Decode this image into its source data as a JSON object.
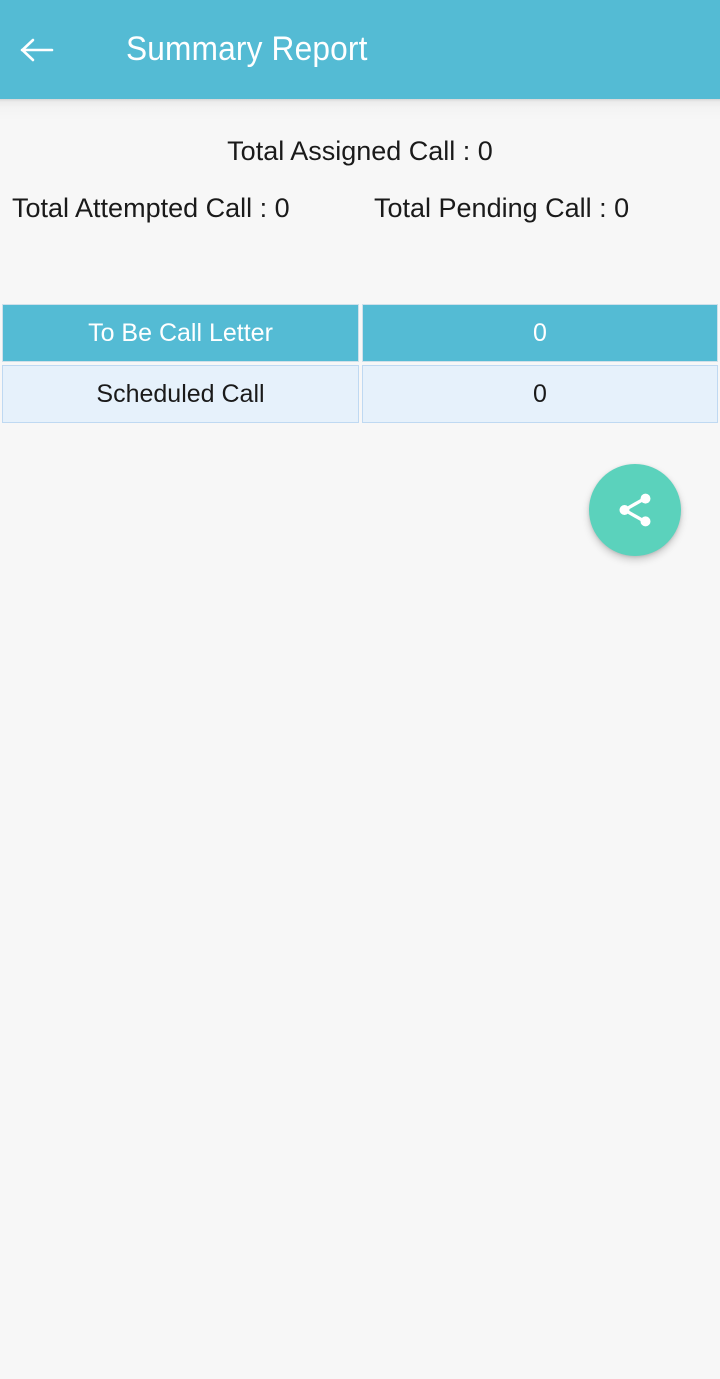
{
  "appbar": {
    "title": "Summary Report",
    "back_icon": "arrow-left-icon",
    "background_color": "#54BBD4",
    "title_color": "#FFFFFF"
  },
  "summary": {
    "total_assigned": "Total Assigned Call : 0",
    "total_attempted": "Total Attempted Call : 0",
    "total_pending": "Total Pending Call : 0"
  },
  "report_table": {
    "rows": [
      {
        "label": "To Be Call Letter",
        "value": "0",
        "style": "highlight"
      },
      {
        "label": "Scheduled Call",
        "value": "0",
        "style": "plain"
      }
    ]
  },
  "fab": {
    "icon": "share-icon",
    "background_color": "#5BD2BC",
    "icon_color": "#FFFFFF"
  },
  "page": {
    "background_color": "#F7F7F7"
  }
}
